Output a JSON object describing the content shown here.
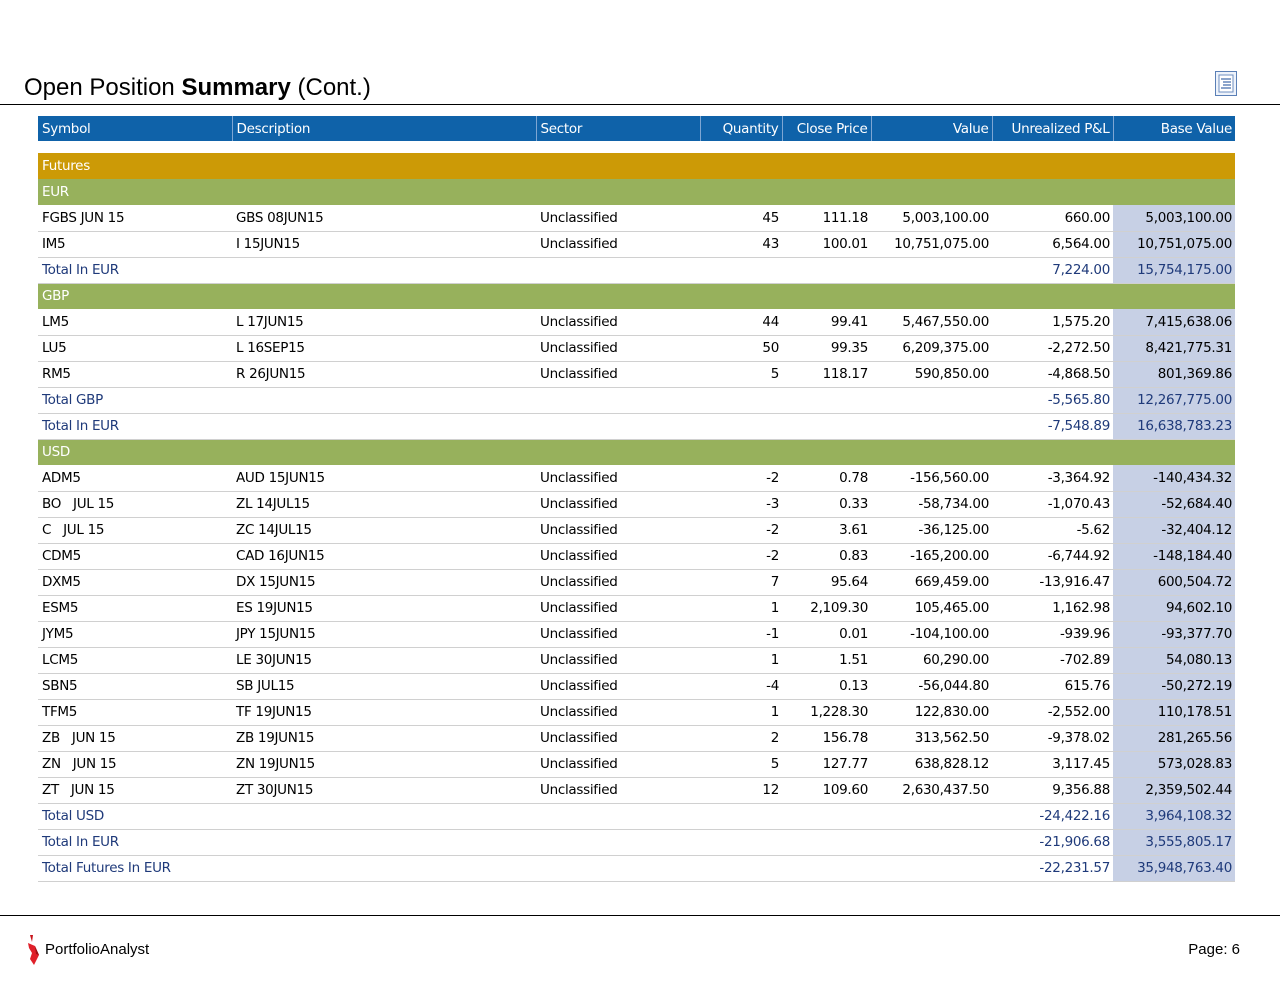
{
  "page": {
    "title_normal": "Open Position ",
    "title_bold": "Summary",
    "title_suffix": " (Cont.)"
  },
  "table": {
    "headers": [
      "Symbol",
      "Description",
      "Sector",
      "Quantity",
      "Close Price",
      "Value",
      "Unrealized P&L",
      "Base Value"
    ],
    "section": "Futures",
    "groups": [
      {
        "name": "EUR",
        "rows": [
          [
            "FGBS JUN 15",
            "GBS 08JUN15",
            "Unclassified",
            "45",
            "111.18",
            "5,003,100.00",
            "660.00",
            "5,003,100.00"
          ],
          [
            "IM5",
            "I 15JUN15",
            "Unclassified",
            "43",
            "100.01",
            "10,751,075.00",
            "6,564.00",
            "10,751,075.00"
          ]
        ],
        "totals": [
          {
            "label": "Total In EUR",
            "pnl": "7,224.00",
            "base": "15,754,175.00"
          }
        ]
      },
      {
        "name": "GBP",
        "rows": [
          [
            "LM5",
            "L 17JUN15",
            "Unclassified",
            "44",
            "99.41",
            "5,467,550.00",
            "1,575.20",
            "7,415,638.06"
          ],
          [
            "LU5",
            "L 16SEP15",
            "Unclassified",
            "50",
            "99.35",
            "6,209,375.00",
            "-2,272.50",
            "8,421,775.31"
          ],
          [
            "RM5",
            "R 26JUN15",
            "Unclassified",
            "5",
            "118.17",
            "590,850.00",
            "-4,868.50",
            "801,369.86"
          ]
        ],
        "totals": [
          {
            "label": "Total GBP",
            "pnl": "-5,565.80",
            "base": "12,267,775.00"
          },
          {
            "label": "Total In EUR",
            "pnl": "-7,548.89",
            "base": "16,638,783.23"
          }
        ]
      },
      {
        "name": "USD",
        "rows": [
          [
            "ADM5",
            "AUD 15JUN15",
            "Unclassified",
            "-2",
            "0.78",
            "-156,560.00",
            "-3,364.92",
            "-140,434.32"
          ],
          [
            "BO   JUL 15",
            "ZL 14JUL15",
            "Unclassified",
            "-3",
            "0.33",
            "-58,734.00",
            "-1,070.43",
            "-52,684.40"
          ],
          [
            "C   JUL 15",
            "ZC 14JUL15",
            "Unclassified",
            "-2",
            "3.61",
            "-36,125.00",
            "-5.62",
            "-32,404.12"
          ],
          [
            "CDM5",
            "CAD 16JUN15",
            "Unclassified",
            "-2",
            "0.83",
            "-165,200.00",
            "-6,744.92",
            "-148,184.40"
          ],
          [
            "DXM5",
            "DX 15JUN15",
            "Unclassified",
            "7",
            "95.64",
            "669,459.00",
            "-13,916.47",
            "600,504.72"
          ],
          [
            "ESM5",
            "ES 19JUN15",
            "Unclassified",
            "1",
            "2,109.30",
            "105,465.00",
            "1,162.98",
            "94,602.10"
          ],
          [
            "JYM5",
            "JPY 15JUN15",
            "Unclassified",
            "-1",
            "0.01",
            "-104,100.00",
            "-939.96",
            "-93,377.70"
          ],
          [
            "LCM5",
            "LE 30JUN15",
            "Unclassified",
            "1",
            "1.51",
            "60,290.00",
            "-702.89",
            "54,080.13"
          ],
          [
            "SBN5",
            "SB JUL15",
            "Unclassified",
            "-4",
            "0.13",
            "-56,044.80",
            "615.76",
            "-50,272.19"
          ],
          [
            "TFM5",
            "TF 19JUN15",
            "Unclassified",
            "1",
            "1,228.30",
            "122,830.00",
            "-2,552.00",
            "110,178.51"
          ],
          [
            "ZB   JUN 15",
            "ZB 19JUN15",
            "Unclassified",
            "2",
            "156.78",
            "313,562.50",
            "-9,378.02",
            "281,265.56"
          ],
          [
            "ZN   JUN 15",
            "ZN 19JUN15",
            "Unclassified",
            "5",
            "127.77",
            "638,828.12",
            "3,117.45",
            "573,028.83"
          ],
          [
            "ZT   JUN 15",
            "ZT 30JUN15",
            "Unclassified",
            "12",
            "109.60",
            "2,630,437.50",
            "9,356.88",
            "2,359,502.44"
          ]
        ],
        "totals": [
          {
            "label": "Total USD",
            "pnl": "-24,422.16",
            "base": "3,964,108.32"
          },
          {
            "label": "Total In EUR",
            "pnl": "-21,906.68",
            "base": "3,555,805.17"
          }
        ]
      }
    ],
    "grand_total": {
      "label": "Total Futures In EUR",
      "pnl": "-22,231.57",
      "base": "35,948,763.40"
    }
  },
  "footer": {
    "brand": "PortfolioAnalyst",
    "page": "Page: 6"
  },
  "icons": {
    "corner": "report-list-icon",
    "logo": "portfolioanalyst-logo-icon"
  },
  "colors": {
    "header_bg": "#0f62a9",
    "section_bg": "#cc9a06",
    "group_bg": "#97b15c",
    "base_value_bg": "#c7d0e5",
    "total_text": "#1f3a7a"
  }
}
